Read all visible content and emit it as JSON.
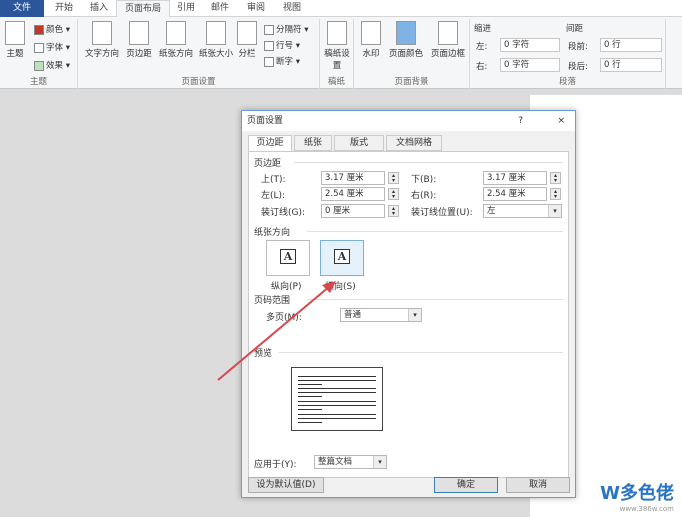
{
  "tabs": [
    "文件",
    "开始",
    "插入",
    "页面布局",
    "引用",
    "邮件",
    "审阅",
    "视图"
  ],
  "ribbon": {
    "theme_group": {
      "label": "主题",
      "theme": "主题",
      "colors": "颜色",
      "fonts": "字体",
      "effects": "效果"
    },
    "page_setup_group": {
      "label": "页面设置",
      "text_direction": "文字方向",
      "margins": "页边距",
      "orientation": "纸张方向",
      "size": "纸张大小",
      "columns": "分栏",
      "breaks": "分隔符",
      "line_numbers": "行号",
      "hyphenation": "断字"
    },
    "manuscript_group": {
      "label": "稿纸",
      "button": "稿纸设置"
    },
    "background_group": {
      "label": "页面背景",
      "watermark": "水印",
      "page_color": "页面颜色",
      "page_borders": "页面边框"
    },
    "paragraph_group": {
      "label": "段落",
      "indent": "缩进",
      "left_label": "左:",
      "left_value": "0 字符",
      "right_label": "右:",
      "right_value": "0 字符",
      "spacing": "间距",
      "before_label": "段前:",
      "before_value": "0 行",
      "after_label": "段后:",
      "after_value": "0 行"
    }
  },
  "dialog": {
    "title": "页面设置",
    "help": "?",
    "close": "×",
    "tabs": [
      "页边距",
      "纸张",
      "版式",
      "文档网格"
    ],
    "margins_section": "页边距",
    "top_label": "上(T):",
    "top_value": "3.17 厘米",
    "bottom_label": "下(B):",
    "bottom_value": "3.17 厘米",
    "left_label": "左(L):",
    "left_value": "2.54 厘米",
    "right_label": "右(R):",
    "right_value": "2.54 厘米",
    "gutter_label": "装订线(G):",
    "gutter_value": "0 厘米",
    "gutter_pos_label": "装订线位置(U):",
    "gutter_pos_value": "左",
    "orientation_section": "纸张方向",
    "portrait": "纵向(P)",
    "landscape": "横向(S)",
    "selected_orientation": "landscape",
    "pages_section": "页码范围",
    "multiple_pages_label": "多页(M):",
    "multiple_pages_value": "普通",
    "preview_section": "预览",
    "apply_to_label": "应用于(Y):",
    "apply_to_value": "整篇文档",
    "set_default": "设为默认值(D)",
    "ok": "确定",
    "cancel": "取消"
  },
  "watermark": {
    "logo": "W多色佬",
    "url": "www.386w.com"
  },
  "colors": {
    "file_tab": "#2b579a",
    "annotation_arrow": "#d9464b"
  }
}
